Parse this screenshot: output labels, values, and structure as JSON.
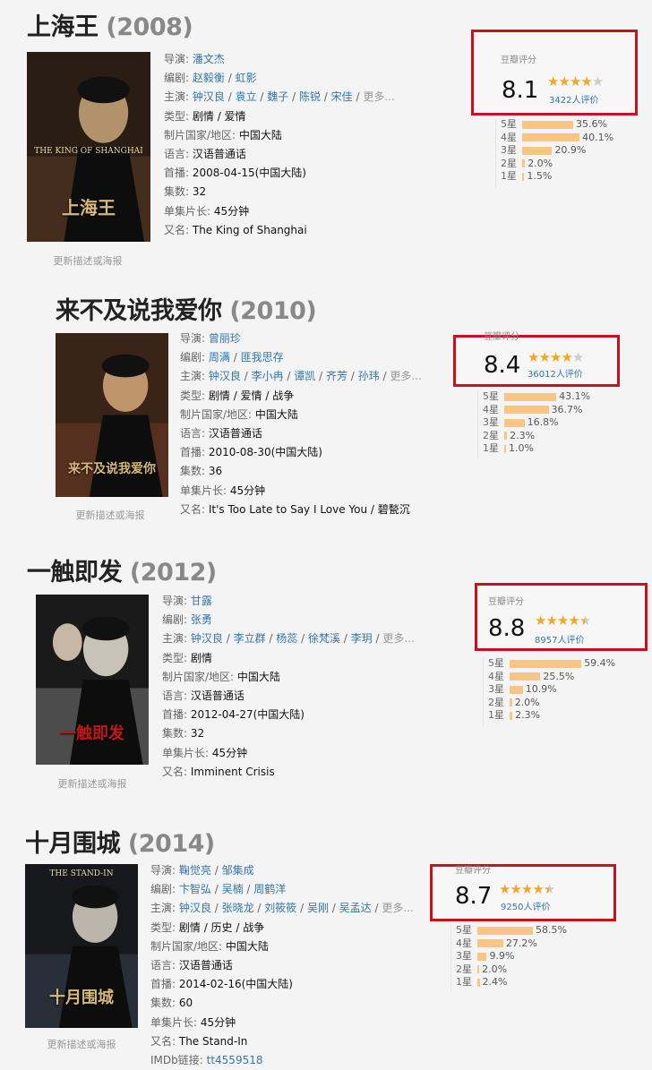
{
  "labels": {
    "director": "导演:",
    "writer": "编剧:",
    "cast": "主演:",
    "genre": "类型:",
    "country": "制片国家/地区:",
    "language": "语言:",
    "premiere": "首播:",
    "episodes": "集数:",
    "runtime": "单集片长:",
    "aka": "又名:",
    "imdb": "IMDb链接:",
    "more": "更多...",
    "update": "更新描述或海报",
    "rating_label": "豆瓣评分",
    "slash": " / "
  },
  "colors": {
    "accent_link": "#3377aa",
    "star": "#f5a623",
    "bar": "#f8c582",
    "highlight_border": "#c8101e"
  },
  "shows": [
    {
      "title": "上海王",
      "year": "(2008)",
      "director": [
        "潘文杰"
      ],
      "writer": [
        "赵毅衡",
        "虹影"
      ],
      "cast": [
        "钟汉良",
        "袁立",
        "魏子",
        "陈锐",
        "宋佳"
      ],
      "genre": "剧情 / 爱情",
      "country": "中国大陆",
      "language": "汉语普通话",
      "premiere": "2008-04-15(中国大陆)",
      "episodes": "32",
      "runtime": "45分钟",
      "aka": "The King of Shanghai",
      "poster": {
        "title_cn": "上海王",
        "title_en": "THE KING OF SHANGHAI"
      },
      "rating": {
        "score": "8.1",
        "stars": 4,
        "count": "3422人评价",
        "dist": [
          {
            "label": "5星",
            "pct": "35.6%",
            "v": 35.6
          },
          {
            "label": "4星",
            "pct": "40.1%",
            "v": 40.1
          },
          {
            "label": "3星",
            "pct": "20.9%",
            "v": 20.9
          },
          {
            "label": "2星",
            "pct": "2.0%",
            "v": 2.0
          },
          {
            "label": "1星",
            "pct": "1.5%",
            "v": 1.5
          }
        ]
      }
    },
    {
      "title": "来不及说我爱你",
      "year": "(2010)",
      "director": [
        "曾丽珍"
      ],
      "writer": [
        "周满",
        "匪我思存"
      ],
      "cast": [
        "钟汉良",
        "李小冉",
        "谭凯",
        "齐芳",
        "孙玮"
      ],
      "genre": "剧情 / 爱情 / 战争",
      "country": "中国大陆",
      "language": "汉语普通话",
      "premiere": "2010-08-30(中国大陆)",
      "episodes": "36",
      "runtime": "45分钟",
      "aka": "It's Too Late to Say I Love You / 碧甃沉",
      "poster": {
        "title_cn": "来不及说我爱你",
        "title_en": ""
      },
      "rating": {
        "score": "8.4",
        "stars": 4,
        "count": "36012人评价",
        "dist": [
          {
            "label": "5星",
            "pct": "43.1%",
            "v": 43.1
          },
          {
            "label": "4星",
            "pct": "36.7%",
            "v": 36.7
          },
          {
            "label": "3星",
            "pct": "16.8%",
            "v": 16.8
          },
          {
            "label": "2星",
            "pct": "2.3%",
            "v": 2.3
          },
          {
            "label": "1星",
            "pct": "1.0%",
            "v": 1.0
          }
        ]
      }
    },
    {
      "title": "一触即发",
      "year": "(2012)",
      "director": [
        "甘露"
      ],
      "writer": [
        "张勇"
      ],
      "cast": [
        "钟汉良",
        "李立群",
        "杨蕊",
        "徐梵溪",
        "李玥"
      ],
      "genre": "剧情",
      "country": "中国大陆",
      "language": "汉语普通话",
      "premiere": "2012-04-27(中国大陆)",
      "episodes": "32",
      "runtime": "45分钟",
      "aka": "Imminent Crisis",
      "poster": {
        "title_cn": "一触即发",
        "title_en": ""
      },
      "rating": {
        "score": "8.8",
        "stars": 4.5,
        "count": "8957人评价",
        "dist": [
          {
            "label": "5星",
            "pct": "59.4%",
            "v": 59.4
          },
          {
            "label": "4星",
            "pct": "25.5%",
            "v": 25.5
          },
          {
            "label": "3星",
            "pct": "10.9%",
            "v": 10.9
          },
          {
            "label": "2星",
            "pct": "2.0%",
            "v": 2.0
          },
          {
            "label": "1星",
            "pct": "2.3%",
            "v": 2.3
          }
        ]
      }
    },
    {
      "title": "十月围城",
      "year": "(2014)",
      "director": [
        "鞠觉亮",
        "邹集成"
      ],
      "writer": [
        "卞智弘",
        "吴楠",
        "周鹤洋"
      ],
      "cast": [
        "钟汉良",
        "张晓龙",
        "刘筱筱",
        "吴刚",
        "吴孟达"
      ],
      "genre": "剧情 / 历史 / 战争",
      "country": "中国大陆",
      "language": "汉语普通话",
      "premiere": "2014-02-16(中国大陆)",
      "episodes": "60",
      "runtime": "45分钟",
      "aka": "The Stand-In",
      "imdb": "tt4559518",
      "poster": {
        "title_cn": "十月围城",
        "title_en": "THE STAND-IN"
      },
      "rating": {
        "score": "8.7",
        "stars": 4.5,
        "count": "9250人评价",
        "dist": [
          {
            "label": "5星",
            "pct": "58.5%",
            "v": 58.5
          },
          {
            "label": "4星",
            "pct": "27.2%",
            "v": 27.2
          },
          {
            "label": "3星",
            "pct": "9.9%",
            "v": 9.9
          },
          {
            "label": "2星",
            "pct": "2.0%",
            "v": 2.0
          },
          {
            "label": "1星",
            "pct": "2.4%",
            "v": 2.4
          }
        ]
      }
    }
  ]
}
